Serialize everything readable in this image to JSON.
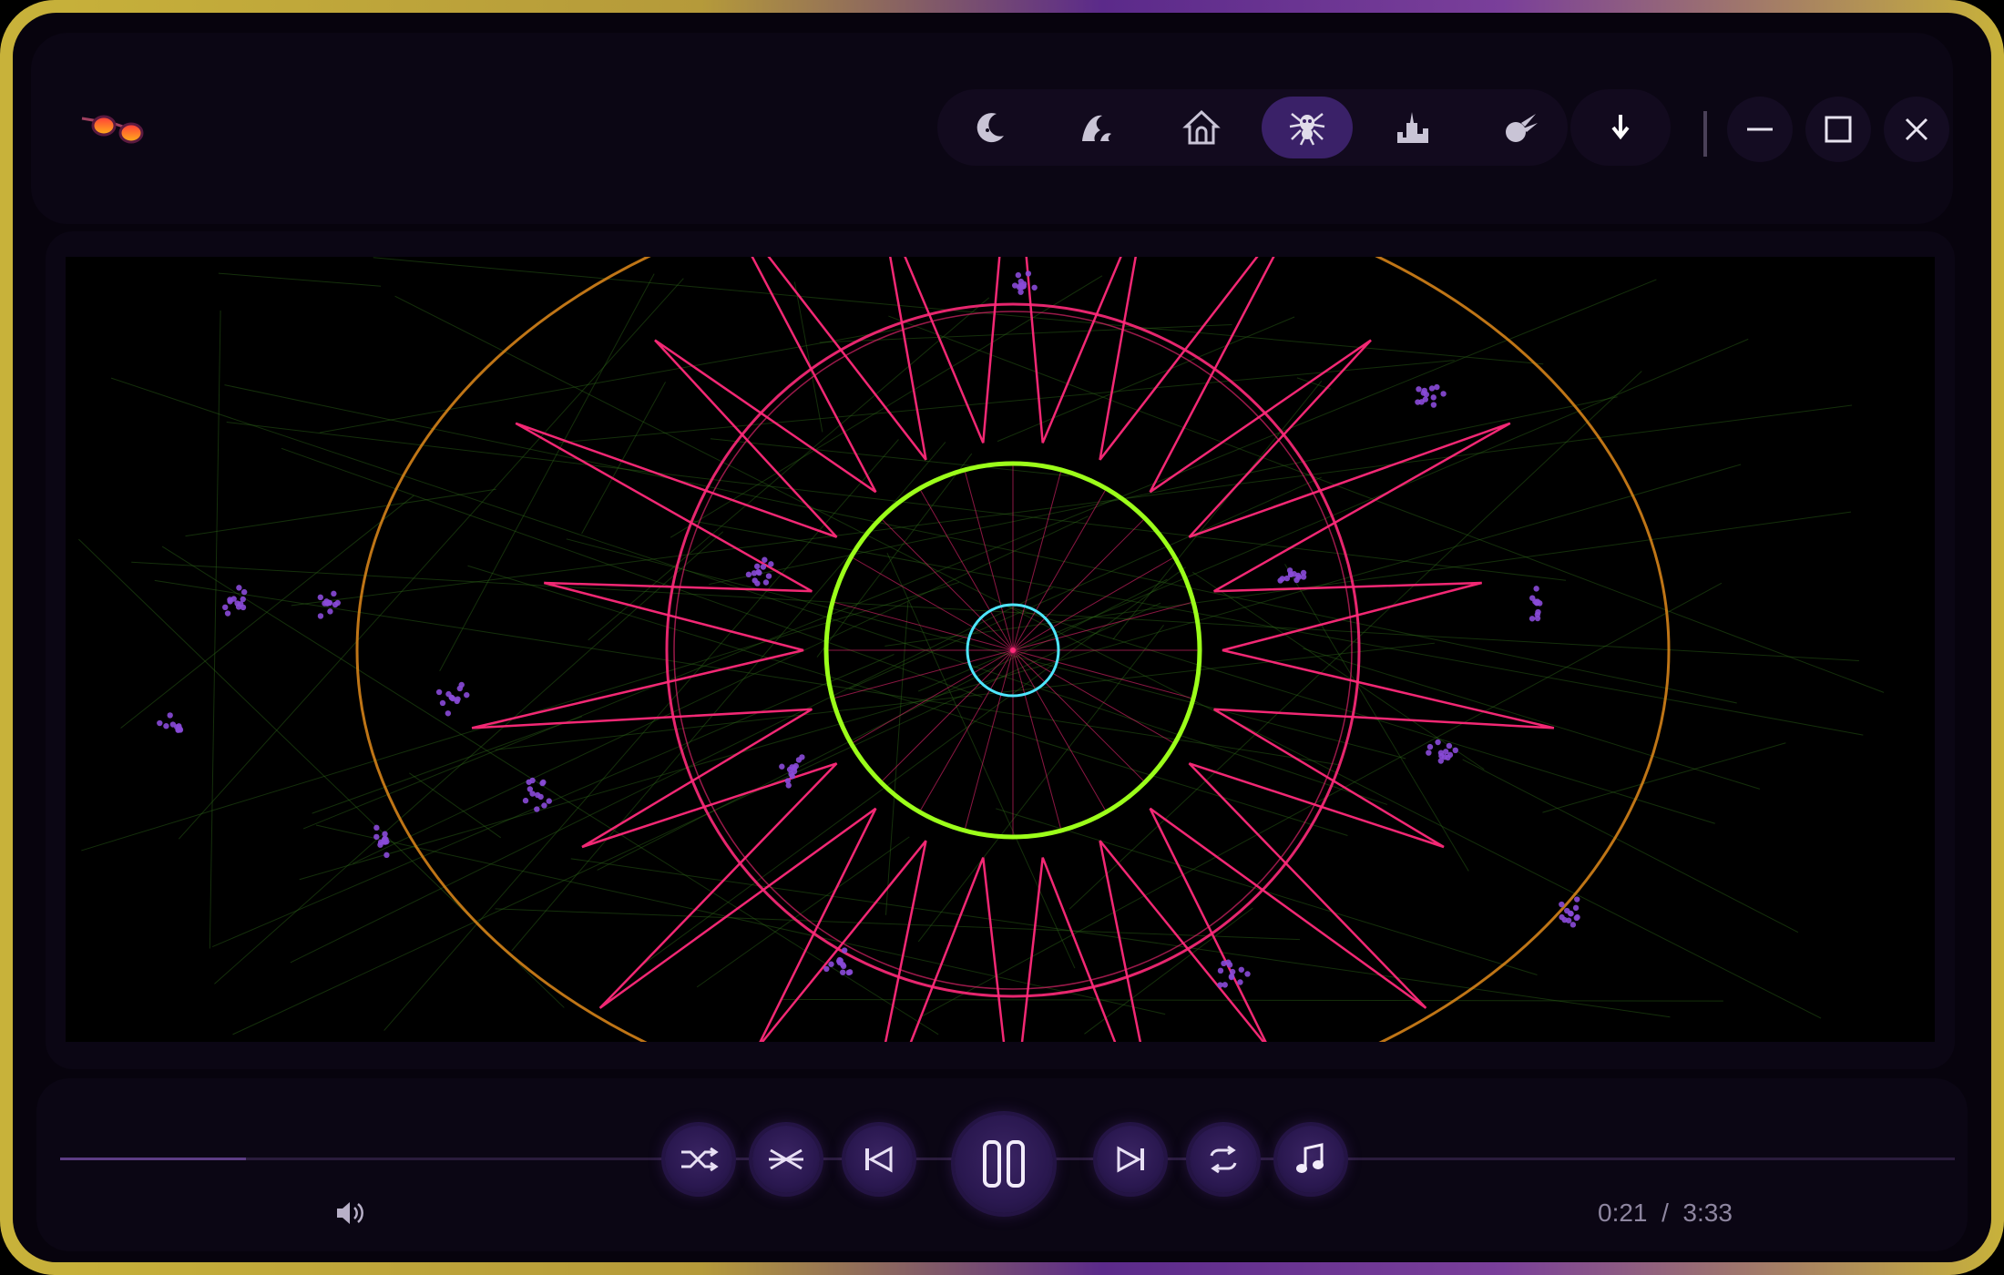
{
  "app": {
    "logo_icon": "sunglasses-icon"
  },
  "tabs": [
    {
      "icon": "moon-icon",
      "active": false
    },
    {
      "icon": "wave-icon",
      "active": false
    },
    {
      "icon": "temple-icon",
      "active": false
    },
    {
      "icon": "spider-icon",
      "active": true
    },
    {
      "icon": "city-icon",
      "active": false
    },
    {
      "icon": "comet-icon",
      "active": false
    }
  ],
  "toolbar": {
    "download_icon": "download-arrow-icon"
  },
  "window_controls": {
    "minimize_icon": "minimize-icon",
    "maximize_icon": "maximize-icon",
    "close_icon": "close-icon"
  },
  "player": {
    "current_time": "0:21",
    "separator": "/",
    "total_time": "3:33",
    "progress": 0.098,
    "buttons": [
      "shuffle-icon",
      "crossfade-icon",
      "previous-icon",
      "pause-icon",
      "next-icon",
      "repeat-icon",
      "music-note-icon"
    ],
    "volume_icon": "speaker-icon"
  },
  "colors": {
    "accent": "#3a2168",
    "frame_gold": "#c8b23a",
    "viz_magenta": "#ff2a7a",
    "viz_lime": "#9cff1a",
    "viz_cyan": "#4ee6ff",
    "viz_orange": "#e08a1a",
    "particles": "#8a4ad8"
  }
}
